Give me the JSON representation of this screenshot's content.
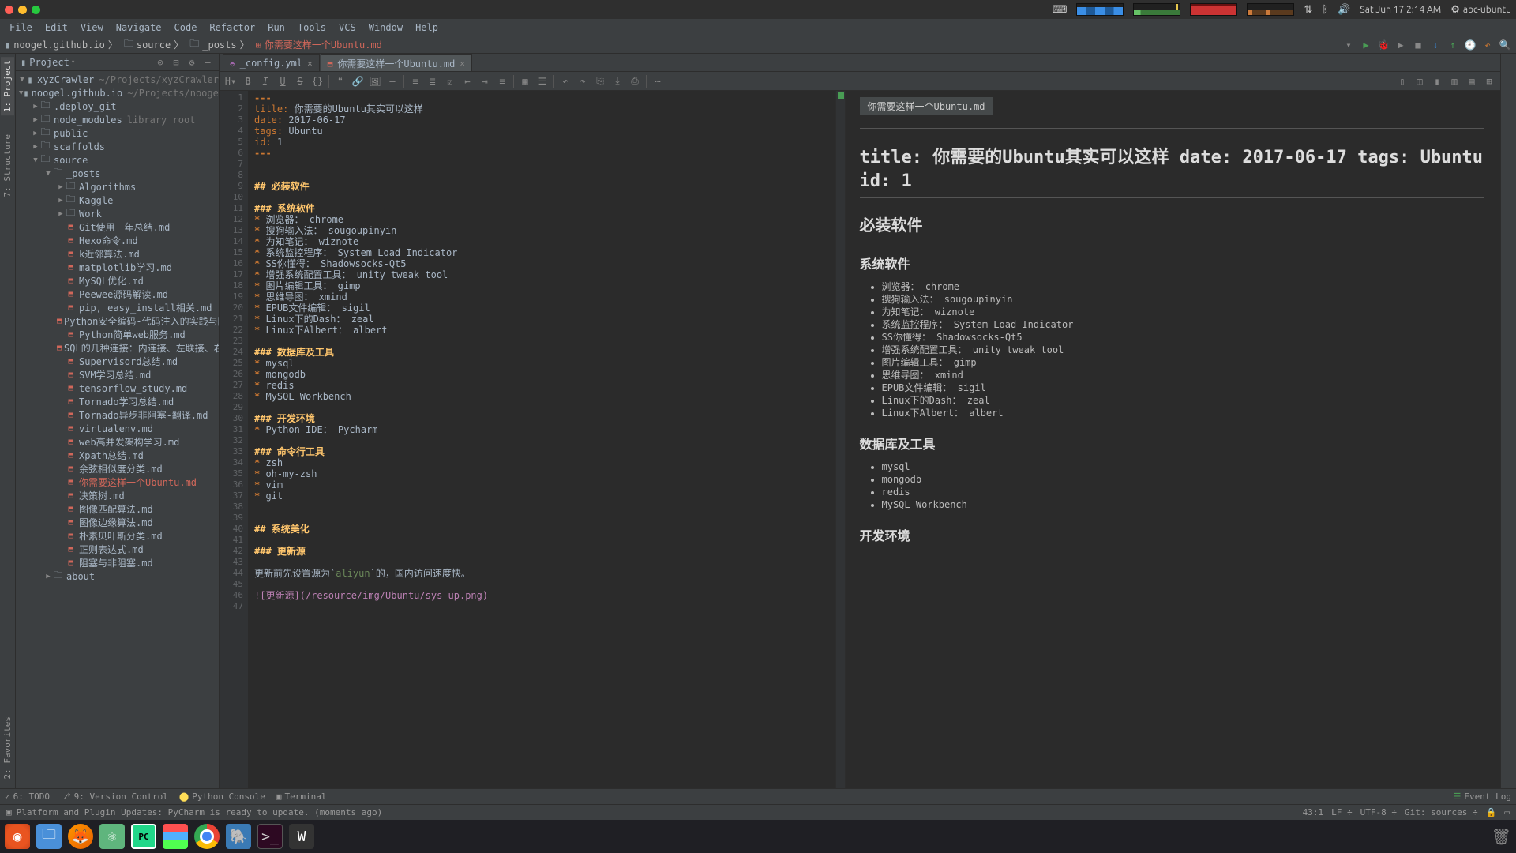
{
  "sysbar": {
    "clock": "Sat Jun 17  2:14 AM",
    "user": "abc-ubuntu"
  },
  "menu": [
    "File",
    "Edit",
    "View",
    "Navigate",
    "Code",
    "Refactor",
    "Run",
    "Tools",
    "VCS",
    "Window",
    "Help"
  ],
  "crumb": {
    "root": "noogel.github.io",
    "p1": "source",
    "p2": "_posts",
    "file": "你需要这样一个Ubuntu.md"
  },
  "project": {
    "title": "Project",
    "tree": [
      {
        "d": 0,
        "t": "proj",
        "a": "▼",
        "n": "xyzCrawler",
        "hint": "~/Projects/xyzCrawler"
      },
      {
        "d": 0,
        "t": "proj",
        "a": "▼",
        "n": "noogel.github.io",
        "hint": "~/Projects/noogel."
      },
      {
        "d": 1,
        "t": "dir",
        "a": "▶",
        "n": ".deploy_git"
      },
      {
        "d": 1,
        "t": "dir",
        "a": "▶",
        "n": "node_modules",
        "hint": "library root"
      },
      {
        "d": 1,
        "t": "dir",
        "a": "▶",
        "n": "public"
      },
      {
        "d": 1,
        "t": "dir",
        "a": "▶",
        "n": "scaffolds"
      },
      {
        "d": 1,
        "t": "dir",
        "a": "▼",
        "n": "source"
      },
      {
        "d": 2,
        "t": "dir",
        "a": "▼",
        "n": "_posts"
      },
      {
        "d": 3,
        "t": "dir",
        "a": "▶",
        "n": "Algorithms"
      },
      {
        "d": 3,
        "t": "dir",
        "a": "▶",
        "n": "Kaggle"
      },
      {
        "d": 3,
        "t": "dir",
        "a": "▶",
        "n": "Work"
      },
      {
        "d": 3,
        "t": "md",
        "n": "Git使用一年总结.md"
      },
      {
        "d": 3,
        "t": "md",
        "n": "Hexo命令.md"
      },
      {
        "d": 3,
        "t": "md",
        "n": "k近邻算法.md"
      },
      {
        "d": 3,
        "t": "md",
        "n": "matplotlib学习.md"
      },
      {
        "d": 3,
        "t": "md",
        "n": "MySQL优化.md"
      },
      {
        "d": 3,
        "t": "md",
        "n": "Peewee源码解读.md"
      },
      {
        "d": 3,
        "t": "md",
        "n": "pip, easy_install相关.md"
      },
      {
        "d": 3,
        "t": "md",
        "n": "Python安全编码-代码注入的实践与防范"
      },
      {
        "d": 3,
        "t": "md",
        "n": "Python简单web服务.md"
      },
      {
        "d": 3,
        "t": "md",
        "n": "SQL的几种连接：内连接、左联接、右连"
      },
      {
        "d": 3,
        "t": "md",
        "n": "Supervisord总结.md"
      },
      {
        "d": 3,
        "t": "md",
        "n": "SVM学习总结.md"
      },
      {
        "d": 3,
        "t": "md",
        "n": "tensorflow_study.md"
      },
      {
        "d": 3,
        "t": "md",
        "n": "Tornado学习总结.md"
      },
      {
        "d": 3,
        "t": "md",
        "n": "Tornado异步非阻塞-翻译.md"
      },
      {
        "d": 3,
        "t": "md",
        "n": "virtualenv.md"
      },
      {
        "d": 3,
        "t": "md",
        "n": "web高并发架构学习.md"
      },
      {
        "d": 3,
        "t": "md",
        "n": "Xpath总结.md"
      },
      {
        "d": 3,
        "t": "md",
        "n": "余弦相似度分类.md"
      },
      {
        "d": 3,
        "t": "md",
        "n": "你需要这样一个Ubuntu.md",
        "hl": true
      },
      {
        "d": 3,
        "t": "md",
        "n": "决策树.md"
      },
      {
        "d": 3,
        "t": "md",
        "n": "图像匹配算法.md"
      },
      {
        "d": 3,
        "t": "md",
        "n": "图像边缘算法.md"
      },
      {
        "d": 3,
        "t": "md",
        "n": "朴素贝叶斯分类.md"
      },
      {
        "d": 3,
        "t": "md",
        "n": "正则表达式.md"
      },
      {
        "d": 3,
        "t": "md",
        "n": "阻塞与非阻塞.md"
      },
      {
        "d": 2,
        "t": "dir",
        "a": "▶",
        "n": "about"
      }
    ]
  },
  "tabs": [
    {
      "icon": "yml",
      "label": "_config.yml",
      "active": false
    },
    {
      "icon": "md",
      "label": "你需要这样一个Ubuntu.md",
      "active": true
    }
  ],
  "editor": {
    "lines": [
      {
        "n": 1,
        "h": "<span class='c-b'>---</span>"
      },
      {
        "n": 2,
        "h": "<span class='c-k'>title:</span> 你需要的Ubuntu其实可以这样"
      },
      {
        "n": 3,
        "h": "<span class='c-k'>date:</span> 2017-06-17"
      },
      {
        "n": 4,
        "h": "<span class='c-k'>tags:</span> Ubuntu"
      },
      {
        "n": 5,
        "h": "<span class='c-k'>id:</span> 1"
      },
      {
        "n": 6,
        "h": "<span class='c-b'>---</span>"
      },
      {
        "n": 7,
        "h": ""
      },
      {
        "n": 8,
        "h": ""
      },
      {
        "n": 9,
        "h": "<span class='c-h'>## 必装软件</span>"
      },
      {
        "n": 10,
        "h": ""
      },
      {
        "n": 11,
        "h": "<span class='c-h'>### 系统软件</span>"
      },
      {
        "n": 12,
        "h": "<span class='c-b'>*</span> 浏览器： chrome"
      },
      {
        "n": 13,
        "h": "<span class='c-b'>*</span> 搜狗输入法： sougoupinyin"
      },
      {
        "n": 14,
        "h": "<span class='c-b'>*</span> 为知笔记： wiznote"
      },
      {
        "n": 15,
        "h": "<span class='c-b'>*</span> 系统监控程序： System Load Indicator"
      },
      {
        "n": 16,
        "h": "<span class='c-b'>*</span> SS你懂得： Shadowsocks-Qt5"
      },
      {
        "n": 17,
        "h": "<span class='c-b'>*</span> 增强系统配置工具： unity tweak tool"
      },
      {
        "n": 18,
        "h": "<span class='c-b'>*</span> 图片编辑工具： gimp"
      },
      {
        "n": 19,
        "h": "<span class='c-b'>*</span> 思维导图： xmind"
      },
      {
        "n": 20,
        "h": "<span class='c-b'>*</span> EPUB文件编辑： sigil"
      },
      {
        "n": 21,
        "h": "<span class='c-b'>*</span> Linux下的Dash： zeal"
      },
      {
        "n": 22,
        "h": "<span class='c-b'>*</span> Linux下Albert： albert"
      },
      {
        "n": 23,
        "h": ""
      },
      {
        "n": 24,
        "h": "<span class='c-h'>### 数据库及工具</span>"
      },
      {
        "n": 25,
        "h": "<span class='c-b'>*</span> mysql"
      },
      {
        "n": 26,
        "h": "<span class='c-b'>*</span> mongodb"
      },
      {
        "n": 27,
        "h": "<span class='c-b'>*</span> redis"
      },
      {
        "n": 28,
        "h": "<span class='c-b'>*</span> MySQL Workbench"
      },
      {
        "n": 29,
        "h": ""
      },
      {
        "n": 30,
        "h": "<span class='c-h'>### 开发环境</span>"
      },
      {
        "n": 31,
        "h": "<span class='c-b'>*</span> Python IDE： Pycharm"
      },
      {
        "n": 32,
        "h": ""
      },
      {
        "n": 33,
        "h": "<span class='c-h'>### 命令行工具</span>"
      },
      {
        "n": 34,
        "h": "<span class='c-b'>*</span> zsh"
      },
      {
        "n": 35,
        "h": "<span class='c-b'>*</span> oh-my-zsh"
      },
      {
        "n": 36,
        "h": "<span class='c-b'>*</span> vim"
      },
      {
        "n": 37,
        "h": "<span class='c-b'>*</span> git"
      },
      {
        "n": 38,
        "h": ""
      },
      {
        "n": 39,
        "h": ""
      },
      {
        "n": 40,
        "h": "<span class='c-h'>## 系统美化</span>"
      },
      {
        "n": 41,
        "h": ""
      },
      {
        "n": 42,
        "h": "<span class='c-h'>### 更新源</span>"
      },
      {
        "n": 43,
        "h": ""
      },
      {
        "n": 44,
        "h": "更新前先设置源为`<span class='c-s'>aliyun</span>`的，国内访问速度快。"
      },
      {
        "n": 45,
        "h": ""
      },
      {
        "n": 46,
        "h": "<span class='c-img'>![更新源](/resource/img/Ubuntu/sys-up.png)</span>"
      },
      {
        "n": 47,
        "h": ""
      }
    ]
  },
  "preview": {
    "chip": "你需要这样一个Ubuntu.md",
    "h1": "title: 你需要的Ubuntu其实可以这样 date: 2017-06-17 tags: Ubuntu id: 1",
    "h2a": "必装软件",
    "h3a": "系统软件",
    "list1": [
      "浏览器： chrome",
      "搜狗输入法： sougoupinyin",
      "为知笔记： wiznote",
      "系统监控程序： System Load Indicator",
      "SS你懂得： Shadowsocks-Qt5",
      "增强系统配置工具： unity tweak tool",
      "图片编辑工具： gimp",
      "思维导图： xmind",
      "EPUB文件编辑： sigil",
      "Linux下的Dash： zeal",
      "Linux下Albert： albert"
    ],
    "h3b": "数据库及工具",
    "list2": [
      "mysql",
      "mongodb",
      "redis",
      "MySQL Workbench"
    ],
    "h3c": "开发环境"
  },
  "btoolbar": {
    "todo": "6: TODO",
    "vcs": "9: Version Control",
    "pyconsole": "Python Console",
    "terminal": "Terminal",
    "eventlog": "Event Log"
  },
  "status": {
    "msg": "Platform and Plugin Updates: PyCharm is ready to update. (moments ago)",
    "pos": "43:1",
    "lf": "LF ÷",
    "enc": "UTF-8 ÷",
    "git": "Git: sources ÷"
  }
}
